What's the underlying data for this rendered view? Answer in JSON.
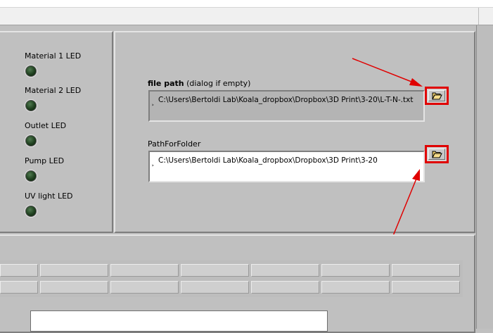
{
  "leds": [
    {
      "label": "Material 1 LED"
    },
    {
      "label": "Material 2 LED"
    },
    {
      "label": "Outlet LED"
    },
    {
      "label": "Pump LED"
    },
    {
      "label": "UV light LED"
    }
  ],
  "file_path": {
    "label_bold": "file path",
    "label_suffix": " (dialog if empty)",
    "value": "C:\\Users\\Bertoldi Lab\\Koala_dropbox\\Dropbox\\3D Print\\3-20\\L-T-N-.txt"
  },
  "folder_path": {
    "label": "PathForFolder",
    "value": "C:\\Users\\Bertoldi Lab\\Koala_dropbox\\Dropbox\\3D Print\\3-20"
  },
  "icons": {
    "browse": "folder-open-icon",
    "path_glyph": "path-indicator-icon"
  },
  "colors": {
    "panel_bg": "#c0c0c0",
    "highlight_red": "#e00000",
    "led_off": "#1f3f1f"
  }
}
